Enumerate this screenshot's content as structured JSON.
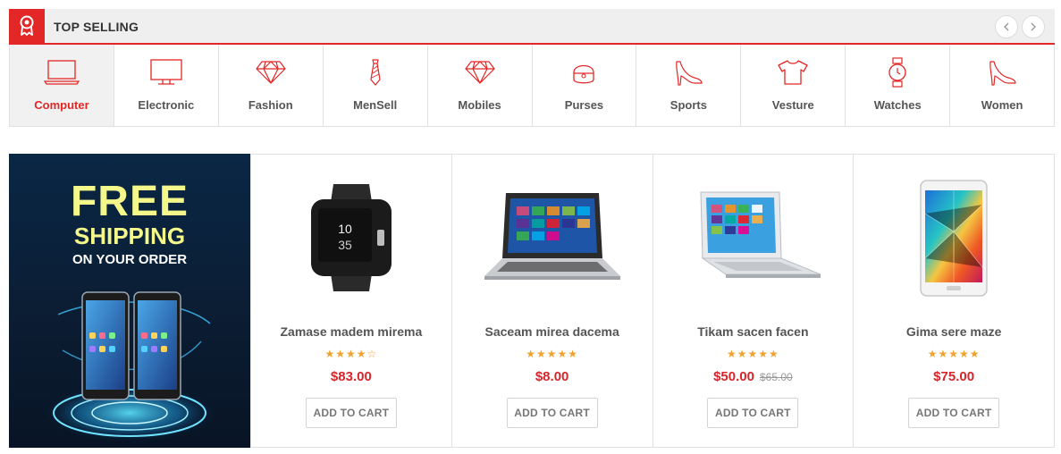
{
  "header": {
    "title": "TOP SELLING",
    "badge_icon": "award-ribbon-icon",
    "prev_icon": "chevron-left-icon",
    "next_icon": "chevron-right-icon",
    "accent_color": "#e32626"
  },
  "categories": [
    {
      "label": "Computer",
      "icon": "laptop-icon",
      "active": true
    },
    {
      "label": "Electronic",
      "icon": "monitor-icon",
      "active": false
    },
    {
      "label": "Fashion",
      "icon": "diamond-icon",
      "active": false
    },
    {
      "label": "MenSell",
      "icon": "necktie-icon",
      "active": false
    },
    {
      "label": "Mobiles",
      "icon": "diamond-icon",
      "active": false
    },
    {
      "label": "Purses",
      "icon": "purse-icon",
      "active": false
    },
    {
      "label": "Sports",
      "icon": "high-heel-icon",
      "active": false
    },
    {
      "label": "Vesture",
      "icon": "tshirt-icon",
      "active": false
    },
    {
      "label": "Watches",
      "icon": "wristwatch-icon",
      "active": false
    },
    {
      "label": "Women",
      "icon": "high-heel-icon",
      "active": false
    }
  ],
  "promo": {
    "line1": "FREE",
    "line2": "SHIPPING",
    "line3": "ON YOUR ORDER",
    "image": "smartphones-hologram-image"
  },
  "products": [
    {
      "name": "Zamase madem mirema",
      "rating": 4,
      "max_rating": 5,
      "stars": "★★★★",
      "stars_empty": "☆",
      "price": "$83.00",
      "old_price": "",
      "cart_label": "ADD TO CART",
      "image": "smartwatch-image",
      "watch_time": "10",
      "watch_min": "35"
    },
    {
      "name": "Saceam mirea dacema",
      "rating": 5,
      "max_rating": 5,
      "stars": "★★★★★",
      "stars_empty": "",
      "price": "$8.00",
      "old_price": "",
      "cart_label": "ADD TO CART",
      "image": "laptop-image"
    },
    {
      "name": "Tikam sacen facen",
      "rating": 5,
      "max_rating": 5,
      "stars": "★★★★★",
      "stars_empty": "",
      "price": "$50.00",
      "old_price": "$65.00",
      "cart_label": "ADD TO CART",
      "image": "ultrabook-image"
    },
    {
      "name": "Gima sere maze",
      "rating": 5,
      "max_rating": 5,
      "stars": "★★★★★",
      "stars_empty": "",
      "price": "$75.00",
      "old_price": "",
      "cart_label": "ADD TO CART",
      "image": "tablet-image"
    }
  ]
}
